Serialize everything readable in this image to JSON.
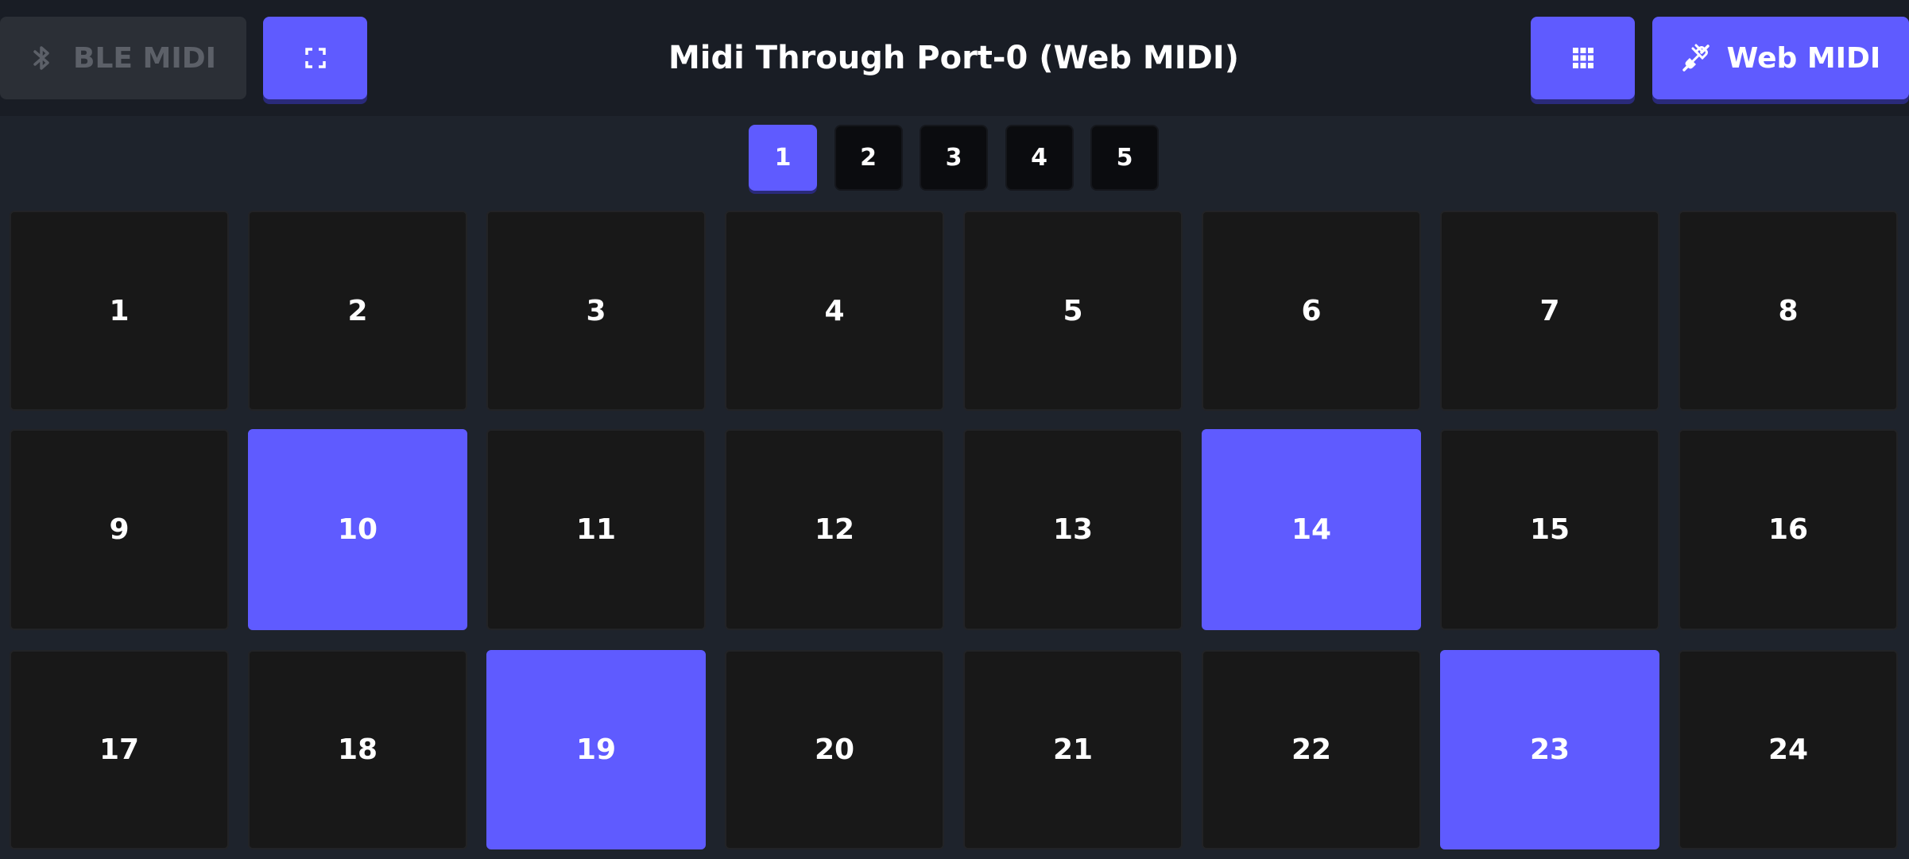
{
  "header": {
    "ble_button_label": "BLE MIDI",
    "title": "Midi Through Port-0 (Web MIDI)",
    "webmidi_button_label": "Web MIDI"
  },
  "icons": {
    "ble": "bluetooth-icon",
    "fullscreen": "fullscreen-icon",
    "grid": "grid-icon",
    "webmidi": "plug-icon"
  },
  "pages": [
    {
      "label": "1",
      "active": true
    },
    {
      "label": "2",
      "active": false
    },
    {
      "label": "3",
      "active": false
    },
    {
      "label": "4",
      "active": false
    },
    {
      "label": "5",
      "active": false
    }
  ],
  "pads": [
    {
      "label": "1",
      "active": false
    },
    {
      "label": "2",
      "active": false
    },
    {
      "label": "3",
      "active": false
    },
    {
      "label": "4",
      "active": false
    },
    {
      "label": "5",
      "active": false
    },
    {
      "label": "6",
      "active": false
    },
    {
      "label": "7",
      "active": false
    },
    {
      "label": "8",
      "active": false
    },
    {
      "label": "9",
      "active": false
    },
    {
      "label": "10",
      "active": true
    },
    {
      "label": "11",
      "active": false
    },
    {
      "label": "12",
      "active": false
    },
    {
      "label": "13",
      "active": false
    },
    {
      "label": "14",
      "active": true
    },
    {
      "label": "15",
      "active": false
    },
    {
      "label": "16",
      "active": false
    },
    {
      "label": "17",
      "active": false
    },
    {
      "label": "18",
      "active": false
    },
    {
      "label": "19",
      "active": true
    },
    {
      "label": "20",
      "active": false
    },
    {
      "label": "21",
      "active": false
    },
    {
      "label": "22",
      "active": false
    },
    {
      "label": "23",
      "active": true
    },
    {
      "label": "24",
      "active": false
    }
  ],
  "colors": {
    "accent": "#5f5bff",
    "pad": "#181818",
    "background": "#1e232c",
    "header": "#191d25",
    "disabled_button": "#2b2f36"
  }
}
